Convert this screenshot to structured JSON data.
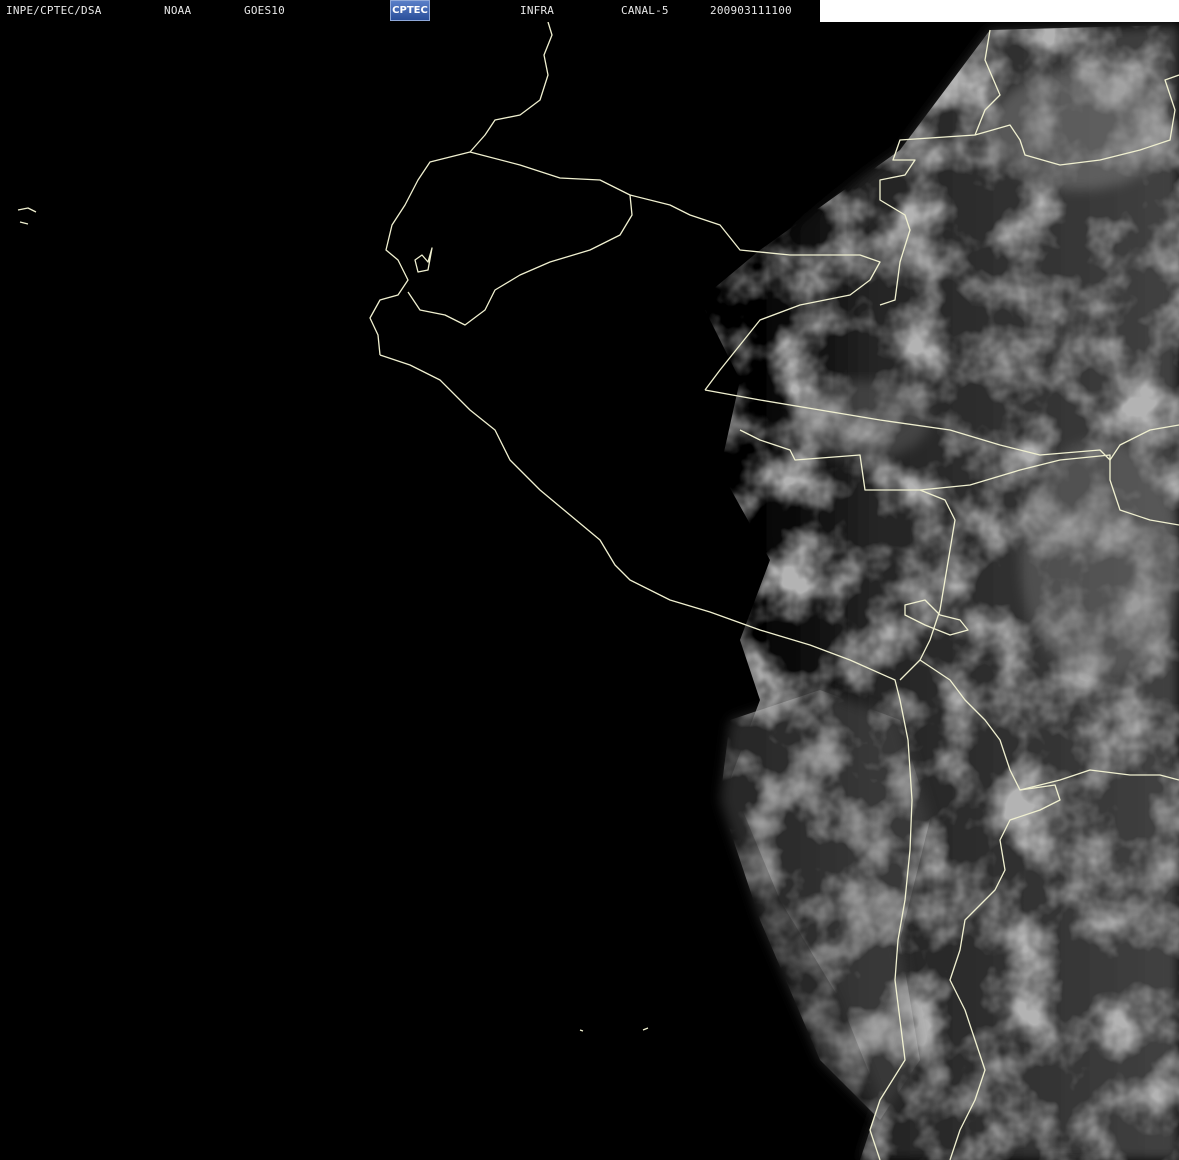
{
  "header": {
    "agency": "INPE/CPTEC/DSA",
    "source": "NOAA",
    "satellite": "GOES10",
    "logo_text": "CPTEC",
    "product": "INFRA",
    "channel": "CANAL-5",
    "timestamp": "200903111100"
  },
  "colors": {
    "background": "#000000",
    "header_text": "#e8e8e8",
    "border_lines": "#f0f0d0",
    "cloud_gray": "#5a5a5a",
    "logo_blue": "#3a5fb0"
  },
  "layers": {
    "imagery": "infrared cloud field",
    "overlay": "country borders and coastline"
  }
}
